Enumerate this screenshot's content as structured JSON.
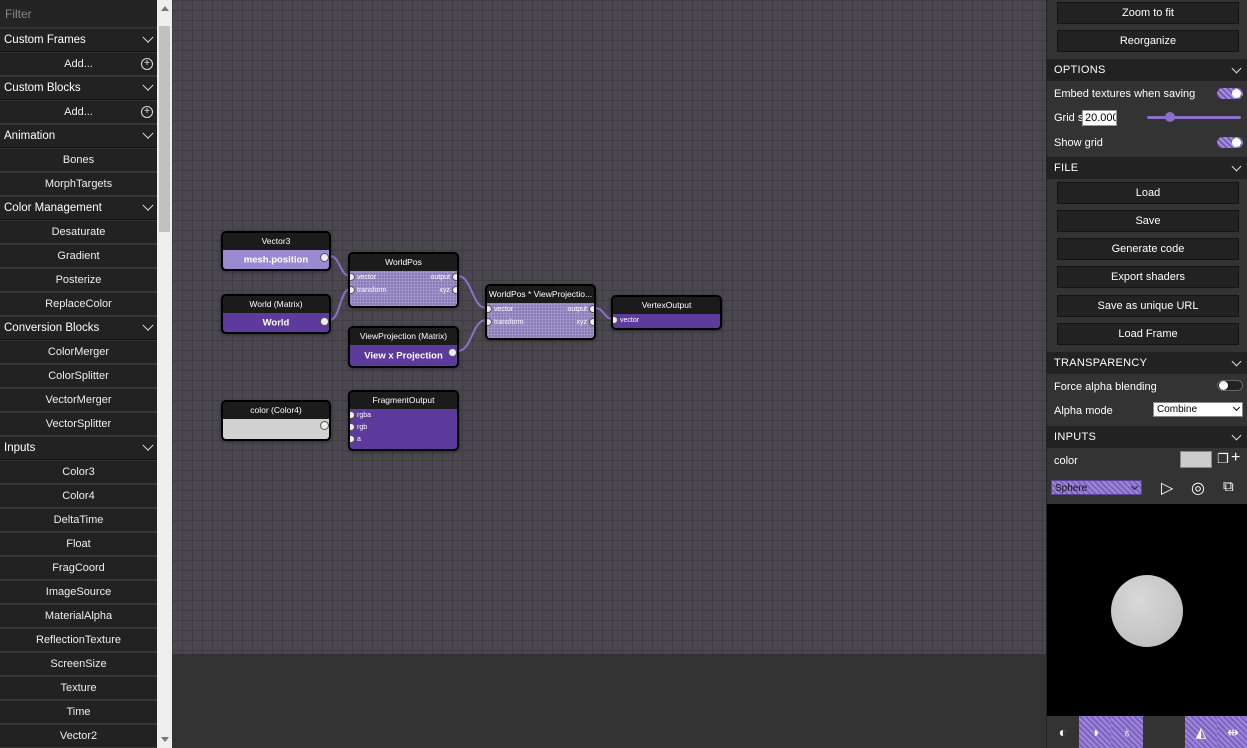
{
  "left_panel": {
    "filter_placeholder": "Filter",
    "categories": [
      {
        "label": "Custom Frames",
        "items": [
          {
            "label": "Add...",
            "icon": "add-circle-icon"
          }
        ]
      },
      {
        "label": "Custom Blocks",
        "items": [
          {
            "label": "Add...",
            "icon": "add-circle-icon"
          }
        ]
      },
      {
        "label": "Animation",
        "items": [
          {
            "label": "Bones"
          },
          {
            "label": "MorphTargets"
          }
        ]
      },
      {
        "label": "Color Management",
        "items": [
          {
            "label": "Desaturate"
          },
          {
            "label": "Gradient"
          },
          {
            "label": "Posterize"
          },
          {
            "label": "ReplaceColor"
          }
        ]
      },
      {
        "label": "Conversion Blocks",
        "items": [
          {
            "label": "ColorMerger"
          },
          {
            "label": "ColorSplitter"
          },
          {
            "label": "VectorMerger"
          },
          {
            "label": "VectorSplitter"
          }
        ]
      },
      {
        "label": "Inputs",
        "items": [
          {
            "label": "Color3"
          },
          {
            "label": "Color4"
          },
          {
            "label": "DeltaTime"
          },
          {
            "label": "Float"
          },
          {
            "label": "FragCoord"
          },
          {
            "label": "ImageSource"
          },
          {
            "label": "MaterialAlpha"
          },
          {
            "label": "ReflectionTexture"
          },
          {
            "label": "ScreenSize"
          },
          {
            "label": "Texture"
          },
          {
            "label": "Time"
          },
          {
            "label": "Vector2"
          }
        ]
      }
    ]
  },
  "graph": {
    "nodes": {
      "vector3": {
        "title": "Vector3",
        "value": "mesh.position"
      },
      "world": {
        "title": "World (Matrix)",
        "value": "World"
      },
      "worldpos": {
        "title": "WorldPos",
        "in1": "vector",
        "in2": "transform",
        "out1": "output",
        "out2": "xyz"
      },
      "viewproj": {
        "title": "ViewProjection (Matrix)",
        "value": "View x Projection"
      },
      "wvp": {
        "title": "WorldPos * ViewProjectio...",
        "in1": "vector",
        "in2": "transform",
        "out1": "output",
        "out2": "xyz"
      },
      "vertexout": {
        "title": "VertexOutput",
        "in1": "vector"
      },
      "color4": {
        "title": "color (Color4)"
      },
      "fragout": {
        "title": "FragmentOutput",
        "in1": "rgba",
        "in2": "rgb",
        "in3": "a"
      }
    }
  },
  "right_panel": {
    "zoom_to_fit": "Zoom to fit",
    "reorganize": "Reorganize",
    "options": {
      "header": "OPTIONS",
      "embed_textures": "Embed textures when saving",
      "embed_textures_on": true,
      "grid_size_label": "Grid size",
      "grid_size_value": "20.000",
      "show_grid": "Show grid",
      "show_grid_on": true
    },
    "file": {
      "header": "FILE",
      "load": "Load",
      "save": "Save",
      "generate_code": "Generate code",
      "export_shaders": "Export shaders",
      "save_url": "Save as unique URL",
      "load_frame": "Load Frame"
    },
    "transparency": {
      "header": "TRANSPARENCY",
      "force_alpha": "Force alpha blending",
      "force_alpha_on": false,
      "alpha_mode_label": "Alpha mode",
      "alpha_mode_value": "Combine"
    },
    "inputs": {
      "header": "INPUTS",
      "color_label": "color",
      "color_value": "#cccccc"
    },
    "preview": {
      "mesh": "Sphere"
    }
  },
  "colors": {
    "accent": "#8b6fc9",
    "node_body": "#5c3b9c",
    "canvas_bg": "#4a474f"
  }
}
